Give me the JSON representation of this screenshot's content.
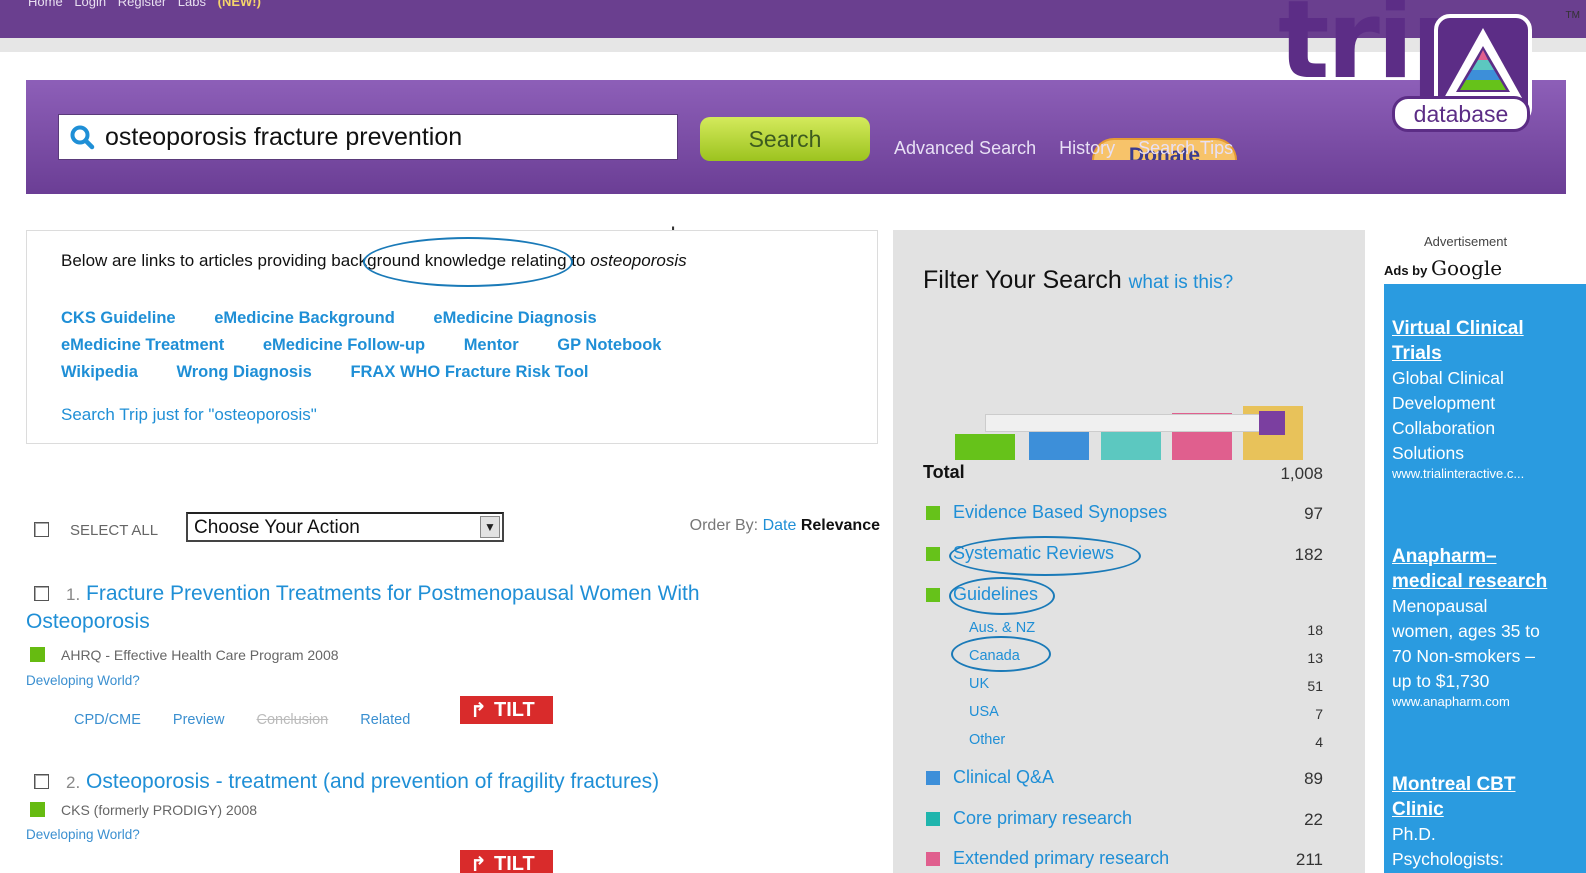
{
  "topbar": {
    "home": "Home",
    "login": "Login",
    "register": "Register",
    "labs": "Labs",
    "new": "(NEW!)"
  },
  "header": {
    "search_value": "osteoporosis fracture prevention",
    "search_button": "Search",
    "links": [
      "Advanced Search",
      "History",
      "Search Tips"
    ],
    "donate": "Donate"
  },
  "logo": {
    "trip": "trip",
    "database": "database",
    "tm": "TM"
  },
  "background": {
    "intro_before": "Below are links to articles providing ",
    "intro_highlight": "background knowledge",
    "intro_after": " relating to ",
    "intro_term": "osteoporosis",
    "rows": [
      [
        "CKS Guideline",
        "eMedicine Background",
        "eMedicine Diagnosis"
      ],
      [
        "eMedicine Treatment",
        "eMedicine Follow-up",
        "Mentor",
        "GP Notebook"
      ],
      [
        "Wikipedia",
        "Wrong Diagnosis",
        "FRAX WHO Fracture Risk Tool"
      ]
    ],
    "search_just": "Search Trip just for \"osteoporosis\""
  },
  "actions": {
    "select_all": "SELECT ALL",
    "choose_action": "Choose Your Action",
    "order_by": "Order By:",
    "order_date": "Date",
    "order_relevance": "Relevance"
  },
  "results": [
    {
      "num": "1.",
      "title_line1": "Fracture Prevention Treatments for Postmenopausal Women With",
      "title_line2": "Osteoporosis",
      "source": "AHRQ - Effective Health Care Program 2008",
      "developing": "Developing World?",
      "links": [
        "CPD/CME",
        "Preview",
        "Conclusion",
        "Related"
      ],
      "tilt": "TILT"
    },
    {
      "num": "2.",
      "title_line1": "Osteoporosis - treatment (and prevention of fragility fractures)",
      "source": "CKS (formerly PRODIGY) 2008",
      "developing": "Developing World?",
      "tilt": "TILT"
    }
  ],
  "filter": {
    "title": "Filter Your Search",
    "what": "what is this?",
    "bar_colors": [
      "#66c21a",
      "#3d8fd9",
      "#5cc8c0",
      "#e05f8e",
      "#e8c25a"
    ],
    "total_label": "Total",
    "total_count": "1,008",
    "rows": [
      {
        "label": "Evidence Based Synopses",
        "count": "97",
        "color": "#66c21a"
      },
      {
        "label": "Systematic Reviews",
        "count": "182",
        "color": "#66c21a"
      },
      {
        "label": "Guidelines",
        "count": "",
        "color": "#66c21a"
      }
    ],
    "guideline_subs": [
      {
        "label": "Aus. & NZ",
        "count": "18"
      },
      {
        "label": "Canada",
        "count": "13"
      },
      {
        "label": "UK",
        "count": "51"
      },
      {
        "label": "USA",
        "count": "7"
      },
      {
        "label": "Other",
        "count": "4"
      }
    ],
    "rows2": [
      {
        "label": "Clinical Q&A",
        "count": "89",
        "color": "#3d8fd9"
      },
      {
        "label": "Core primary research",
        "count": "22",
        "color": "#1fb5ad"
      },
      {
        "label": "Extended primary research",
        "count": "211",
        "color": "#e05f8e"
      }
    ]
  },
  "ads": {
    "advertisement": "Advertisement",
    "ads_by": "Ads by",
    "google": "Google",
    "items": [
      {
        "h1": "Virtual Clinical",
        "h2": "Trials",
        "body": [
          "Global Clinical",
          "Development",
          "Collaboration",
          "Solutions"
        ],
        "url": "www.trialinteractive.c..."
      },
      {
        "h1": "Anapharm–",
        "h2": "medical research",
        "body": [
          "Menopausal",
          "women, ages 35 to",
          "70 Non-smokers –",
          "up to $1,730"
        ],
        "url": "www.anapharm.com"
      },
      {
        "h1": "Montreal CBT",
        "h2": "Clinic",
        "body": [
          "Ph.D.",
          "Psychologists:"
        ],
        "url": ""
      }
    ]
  }
}
